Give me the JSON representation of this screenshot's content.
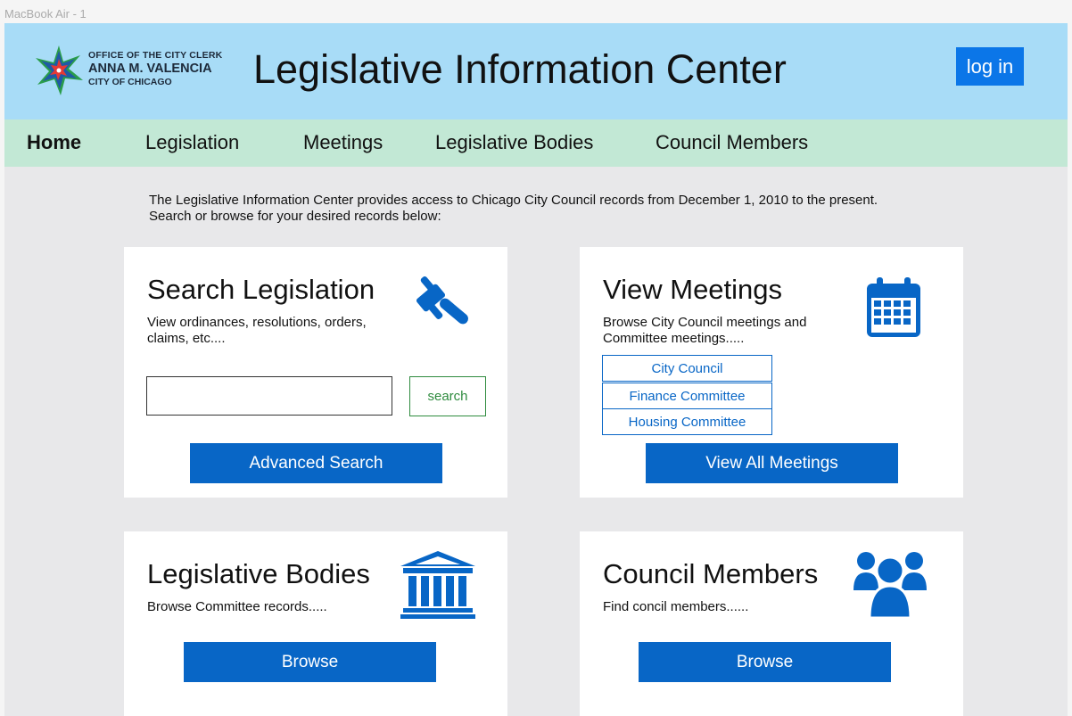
{
  "frame_label": "MacBook Air - 1",
  "header": {
    "logo": {
      "line1": "OFFICE OF THE CITY CLERK",
      "line2": "ANNA M. VALENCIA",
      "line3": "CITY OF CHICAGO"
    },
    "title": "Legislative Information Center",
    "login_label": "log in"
  },
  "nav": {
    "items": [
      {
        "label": "Home",
        "active": true
      },
      {
        "label": "Legislation"
      },
      {
        "label": "Meetings"
      },
      {
        "label": "Legislative Bodies"
      },
      {
        "label": "Council Members"
      }
    ]
  },
  "intro": {
    "line1": "The Legislative Information Center provides access to Chicago City Council records from December 1, 2010 to the present.",
    "line2": "Search or browse for your desired records below:"
  },
  "cards": {
    "search": {
      "title": "Search Legislation",
      "desc_line1": "View ordinances, resolutions, orders,",
      "desc_line2": "claims, etc....",
      "search_value": "",
      "search_label": "search",
      "advanced_label": "Advanced Search",
      "icon": "gavel-icon"
    },
    "meetings": {
      "title": "View Meetings",
      "desc_line1": "Browse City Council meetings and",
      "desc_line2": "Committee meetings.....",
      "links": [
        "City Council",
        "Finance Committee",
        "Housing Committee"
      ],
      "view_all_label": "View All Meetings",
      "icon": "calendar-icon"
    },
    "bodies": {
      "title": "Legislative Bodies",
      "desc": "Browse Committee records.....",
      "browse_label": "Browse",
      "icon": "building-icon"
    },
    "members": {
      "title": "Council Members",
      "desc": "Find concil members......",
      "browse_label": "Browse",
      "icon": "users-icon"
    }
  },
  "colors": {
    "header_bg": "#a8dcf7",
    "nav_bg": "#c2e8d5",
    "page_bg": "#e8e8ea",
    "primary_button": "#0866c6",
    "login_button": "#0b76e8",
    "search_button_border": "#2e8b3e"
  }
}
